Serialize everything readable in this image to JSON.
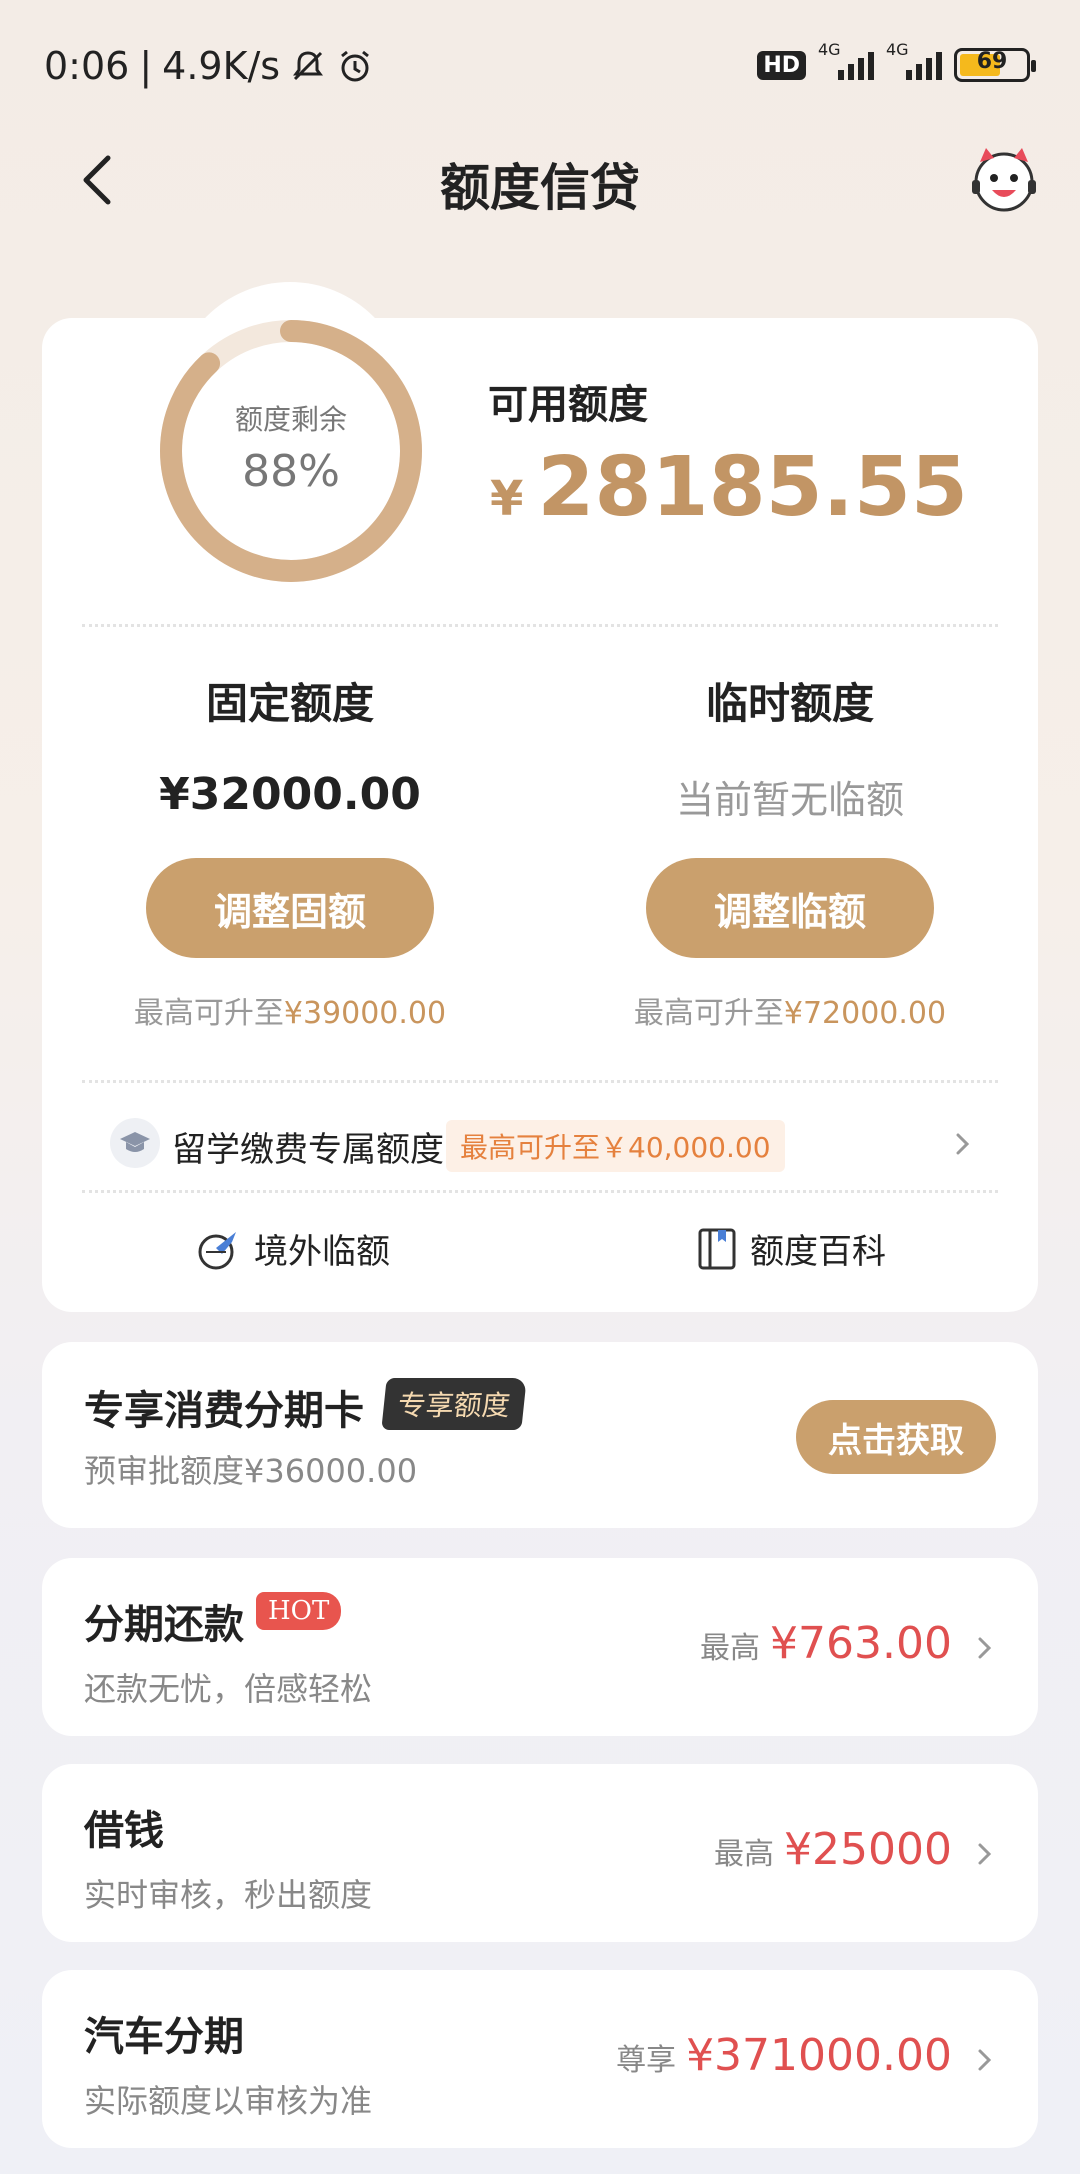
{
  "status_bar": {
    "time": "0:06",
    "net_speed": "4.9K/s",
    "hd": "HD",
    "sig1": "4G",
    "sig2": "4G",
    "battery": "69"
  },
  "nav": {
    "title": "额度信贷"
  },
  "credit": {
    "ring_label": "额度剩余",
    "ring_percent": "88%",
    "ring_fraction": 0.88,
    "available_label": "可用额度",
    "currency": "¥",
    "available_amount": "28185.55",
    "fixed": {
      "title": "固定额度",
      "value": "¥32000.00",
      "button": "调整固额",
      "upgrade_prefix": "最高可升至",
      "upgrade_value": "¥39000.00"
    },
    "temp": {
      "title": "临时额度",
      "value": "当前暂无临额",
      "button": "调整临额",
      "upgrade_prefix": "最高可升至",
      "upgrade_value": "¥72000.00"
    },
    "study": {
      "label": "留学缴费专属额度",
      "badge": "最高可升至￥40,000.00"
    },
    "tools": {
      "overseas": "境外临额",
      "wiki": "额度百科"
    }
  },
  "installment_card": {
    "title": "专享消费分期卡",
    "badge": "专享额度",
    "subtitle": "预审批额度¥36000.00",
    "button": "点击获取"
  },
  "products": [
    {
      "title": "分期还款",
      "hot": "HOT",
      "subtitle": "还款无忧，倍感轻松",
      "prefix": "最高",
      "amount": "¥763.00"
    },
    {
      "title": "借钱",
      "subtitle": "实时审核，秒出额度",
      "prefix": "最高",
      "amount": "¥25000"
    },
    {
      "title": "汽车分期",
      "subtitle": "实际额度以审核为准",
      "prefix": "尊享",
      "amount": "¥371000.00"
    }
  ],
  "colors": {
    "gold": "#caa06d",
    "amount_gold": "#c29565",
    "red": "#e05050",
    "orange": "#e5813e"
  }
}
